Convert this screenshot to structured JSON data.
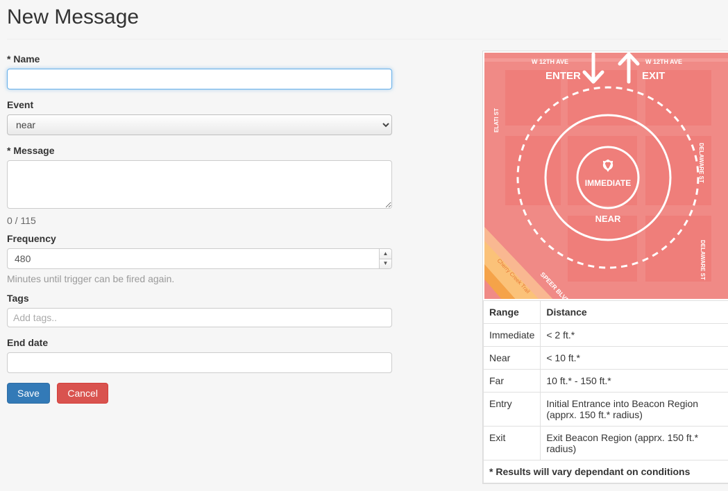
{
  "page": {
    "title": "New Message"
  },
  "labels": {
    "name": "* Name",
    "event": "Event",
    "message": "* Message",
    "frequency": "Frequency",
    "frequency_helper": "Minutes until trigger can be fired again.",
    "tags": "Tags",
    "end_date": "End date"
  },
  "fields": {
    "name": "",
    "event_value": "near",
    "message": "",
    "char_count": "0 / 115",
    "frequency": "480",
    "tags_placeholder": "Add tags..",
    "end_date": ""
  },
  "buttons": {
    "save": "Save",
    "cancel": "Cancel"
  },
  "diagram": {
    "enter": "ENTER",
    "exit": "EXIT",
    "immediate": "IMMEDIATE",
    "near": "NEAR",
    "street_top": "W 12TH AVE",
    "street_top2": "W 12TH AVE",
    "street_left": "ELATI ST",
    "street_right1": "DELAWARE ST",
    "street_right2": "DELAWARE ST",
    "street_diag": "SPEER BLVD",
    "trail": "Cherry Creek Trail"
  },
  "range_table": {
    "headers": {
      "range": "Range",
      "distance": "Distance"
    },
    "rows": [
      {
        "range": "Immediate",
        "distance": "< 2 ft.*"
      },
      {
        "range": "Near",
        "distance": "< 10 ft.*"
      },
      {
        "range": "Far",
        "distance": "10 ft.* - 150 ft.*"
      },
      {
        "range": "Entry",
        "distance": "Initial Entrance into Beacon Region (apprx. 150 ft.* radius)"
      },
      {
        "range": "Exit",
        "distance": "Exit Beacon Region (apprx. 150 ft.* radius)"
      }
    ],
    "footer": "* Results will vary dependant on conditions"
  }
}
